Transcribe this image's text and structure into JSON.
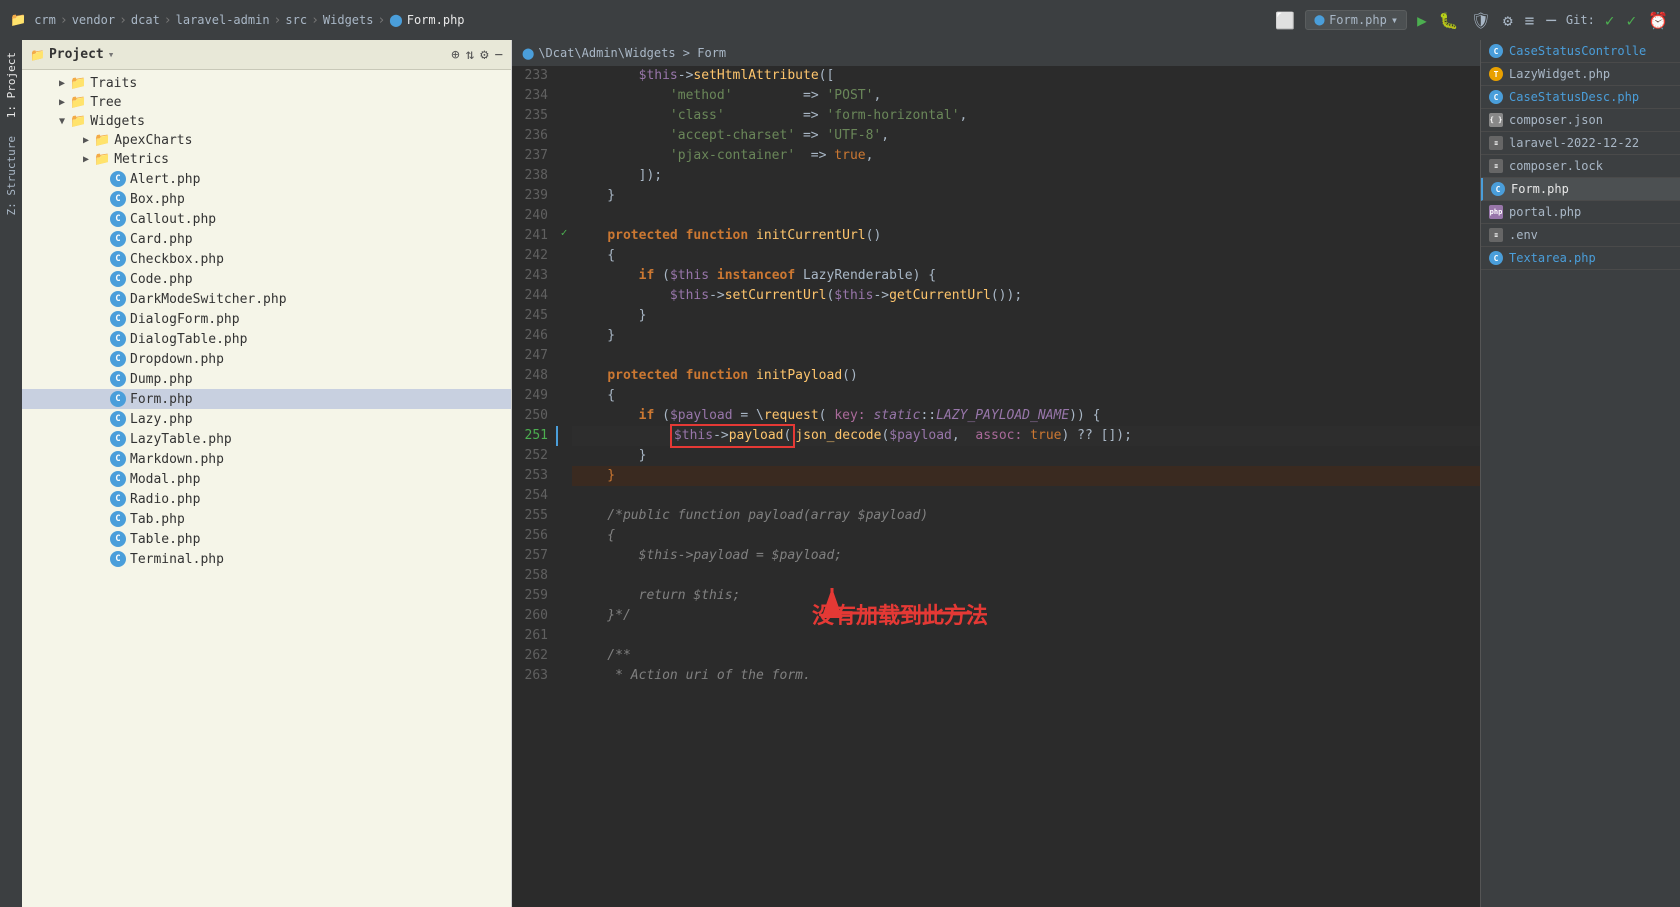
{
  "topbar": {
    "breadcrumbs": [
      "crm",
      "vendor",
      "dcat",
      "laravel-admin",
      "src",
      "Widgets",
      "Form.php"
    ],
    "file_selector": "Form.php",
    "git_label": "Git:"
  },
  "editor_breadcrumb": "\\Dcat\\Admin\\Widgets  >  Form",
  "project_header": {
    "title": "Project",
    "icons": [
      "globe",
      "arrows",
      "gear",
      "minus"
    ]
  },
  "file_tree": {
    "items": [
      {
        "indent": 2,
        "type": "folder",
        "expanded": false,
        "label": "Traits"
      },
      {
        "indent": 2,
        "type": "folder",
        "expanded": false,
        "label": "Tree"
      },
      {
        "indent": 2,
        "type": "folder",
        "expanded": true,
        "label": "Widgets"
      },
      {
        "indent": 4,
        "type": "folder",
        "expanded": false,
        "label": "ApexCharts"
      },
      {
        "indent": 4,
        "type": "folder",
        "expanded": false,
        "label": "Metrics"
      },
      {
        "indent": 4,
        "type": "file-c",
        "label": "Alert.php"
      },
      {
        "indent": 4,
        "type": "file-c",
        "label": "Box.php"
      },
      {
        "indent": 4,
        "type": "file-c",
        "label": "Callout.php"
      },
      {
        "indent": 4,
        "type": "file-c",
        "label": "Card.php"
      },
      {
        "indent": 4,
        "type": "file-c",
        "label": "Checkbox.php"
      },
      {
        "indent": 4,
        "type": "file-c",
        "label": "Code.php"
      },
      {
        "indent": 4,
        "type": "file-c",
        "label": "DarkModeSwitcher.php"
      },
      {
        "indent": 4,
        "type": "file-c",
        "label": "DialogForm.php"
      },
      {
        "indent": 4,
        "type": "file-c",
        "label": "DialogTable.php"
      },
      {
        "indent": 4,
        "type": "file-c",
        "label": "Dropdown.php"
      },
      {
        "indent": 4,
        "type": "file-c",
        "label": "Dump.php"
      },
      {
        "indent": 4,
        "type": "file-c",
        "label": "Form.php",
        "selected": true
      },
      {
        "indent": 4,
        "type": "file-c",
        "label": "Lazy.php"
      },
      {
        "indent": 4,
        "type": "file-c",
        "label": "LazyTable.php"
      },
      {
        "indent": 4,
        "type": "file-c",
        "label": "Markdown.php"
      },
      {
        "indent": 4,
        "type": "file-c",
        "label": "Modal.php"
      },
      {
        "indent": 4,
        "type": "file-c",
        "label": "Radio.php"
      },
      {
        "indent": 4,
        "type": "file-c",
        "label": "Tab.php"
      },
      {
        "indent": 4,
        "type": "file-c",
        "label": "Table.php"
      },
      {
        "indent": 4,
        "type": "file-c",
        "label": "Terminal.php"
      }
    ]
  },
  "code_lines": [
    {
      "num": 233,
      "content": "        $this->setHtmlAttribute(["
    },
    {
      "num": 234,
      "content": "            'method'         => 'POST',"
    },
    {
      "num": 235,
      "content": "            'class'          => 'form-horizontal',"
    },
    {
      "num": 236,
      "content": "            'accept-charset' => 'UTF-8',"
    },
    {
      "num": 237,
      "content": "            'pjax-container'  => true,"
    },
    {
      "num": 238,
      "content": "        ]);"
    },
    {
      "num": 239,
      "content": "    }"
    },
    {
      "num": 240,
      "content": ""
    },
    {
      "num": 241,
      "content": "    protected function initCurrentUrl()"
    },
    {
      "num": 242,
      "content": "    {"
    },
    {
      "num": 243,
      "content": "        if ($this instanceof LazyRenderable) {"
    },
    {
      "num": 244,
      "content": "            $this->setCurrentUrl($this->getCurrentUrl());"
    },
    {
      "num": 245,
      "content": "        }"
    },
    {
      "num": 246,
      "content": "    }"
    },
    {
      "num": 247,
      "content": ""
    },
    {
      "num": 248,
      "content": "    protected function initPayload()"
    },
    {
      "num": 249,
      "content": "    {"
    },
    {
      "num": 250,
      "content": "        if ($payload = \\request( key: static::LAZY_PAYLOAD_NAME)) {"
    },
    {
      "num": 251,
      "content": "            $this->payload(json_decode($payload,  assoc: true) ?? []);",
      "annotated": true
    },
    {
      "num": 252,
      "content": "        }"
    },
    {
      "num": 253,
      "content": "    }"
    },
    {
      "num": 254,
      "content": ""
    },
    {
      "num": 255,
      "content": "    /*public function payload(array $payload)"
    },
    {
      "num": 256,
      "content": "    {"
    },
    {
      "num": 257,
      "content": "        $this->payload = $payload;"
    },
    {
      "num": 258,
      "content": ""
    },
    {
      "num": 259,
      "content": "        return $this;"
    },
    {
      "num": 260,
      "content": "    }*/"
    },
    {
      "num": 261,
      "content": ""
    },
    {
      "num": 262,
      "content": "    /**"
    },
    {
      "num": 263,
      "content": "     * Action uri of the form."
    }
  ],
  "annotation_text": "没有加载到此方法",
  "right_panel": {
    "files": [
      {
        "type": "c",
        "label": "CaseStatusControlle",
        "active": false
      },
      {
        "type": "t",
        "label": "LazyWidget.php",
        "active": false
      },
      {
        "type": "c",
        "label": "CaseStatusDesc.php",
        "active": false
      },
      {
        "type": "json",
        "label": "composer.json",
        "active": false
      },
      {
        "type": "txt",
        "label": "laravel-2022-12-22",
        "active": false
      },
      {
        "type": "json2",
        "label": "composer.lock",
        "active": false
      },
      {
        "type": "c",
        "label": "Form.php",
        "active": true
      },
      {
        "type": "php",
        "label": "portal.php",
        "active": false
      },
      {
        "type": "env",
        "label": ".env",
        "active": false
      },
      {
        "type": "c",
        "label": "Textarea.php",
        "active": false
      }
    ]
  },
  "side_tabs": {
    "labels": [
      "1: Project",
      "Z: Structure"
    ]
  }
}
